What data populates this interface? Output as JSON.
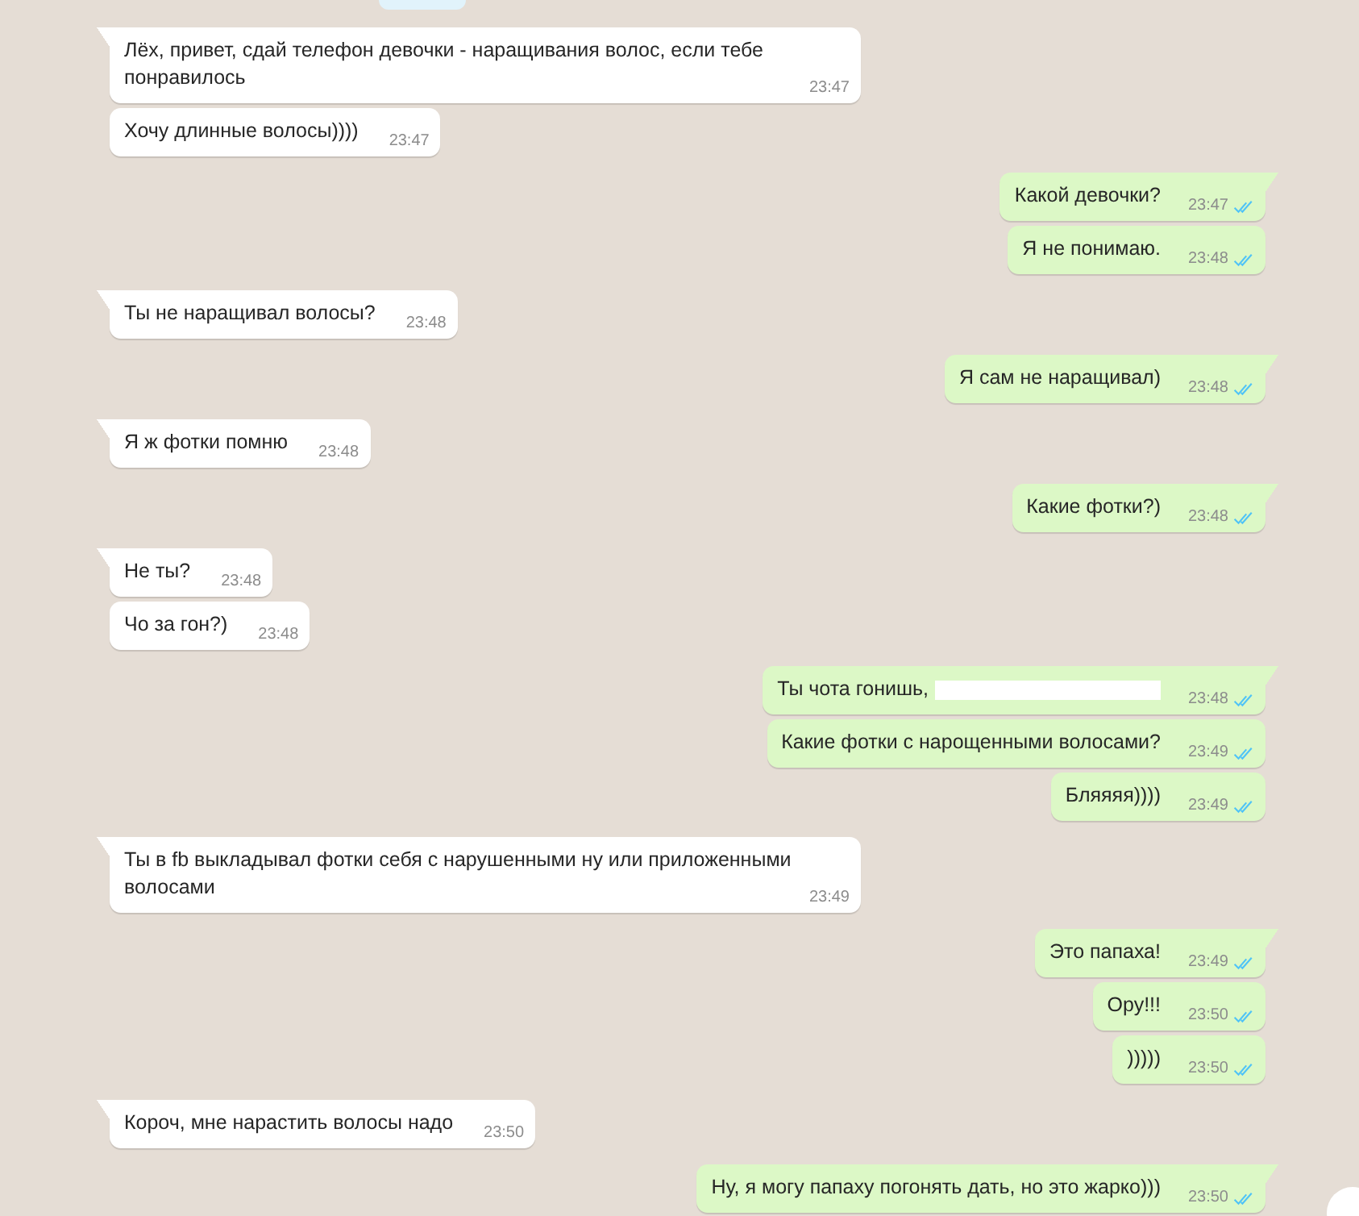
{
  "groups": [
    {
      "outgoing": false,
      "messages": [
        {
          "text": "Лёх, привет, сдай телефон девочки - наращивания волос, если тебе понравилось",
          "time": "23:47"
        },
        {
          "text": "Хочу длинные волосы))))",
          "time": "23:47"
        }
      ]
    },
    {
      "outgoing": true,
      "messages": [
        {
          "text": "Какой девочки?",
          "time": "23:47",
          "read": true
        },
        {
          "text": "Я не понимаю.",
          "time": "23:48",
          "read": true
        }
      ]
    },
    {
      "outgoing": false,
      "messages": [
        {
          "text": "Ты не наращивал волосы?",
          "time": "23:48"
        }
      ]
    },
    {
      "outgoing": true,
      "messages": [
        {
          "text": "Я сам не наращивал)",
          "time": "23:48",
          "read": true
        }
      ]
    },
    {
      "outgoing": false,
      "messages": [
        {
          "text": "Я ж фотки помню",
          "time": "23:48"
        }
      ]
    },
    {
      "outgoing": true,
      "messages": [
        {
          "text": "Какие фотки?)",
          "time": "23:48",
          "read": true
        }
      ]
    },
    {
      "outgoing": false,
      "messages": [
        {
          "text": "Не ты?",
          "time": "23:48"
        },
        {
          "text": "Чо за гон?)",
          "time": "23:48"
        }
      ]
    },
    {
      "outgoing": true,
      "messages": [
        {
          "text": "Ты чота гонишь,",
          "time": "23:48",
          "read": true,
          "redacted": true
        },
        {
          "text": "Какие фотки с нарощенными волосами?",
          "time": "23:49",
          "read": true
        },
        {
          "text": "Бляяяя))))",
          "time": "23:49",
          "read": true
        }
      ]
    },
    {
      "outgoing": false,
      "messages": [
        {
          "text": "Ты в fb выкладывал фотки себя с нарушенными ну или приложенными волосами",
          "time": "23:49"
        }
      ]
    },
    {
      "outgoing": true,
      "messages": [
        {
          "text": "Это папаха!",
          "time": "23:49",
          "read": true
        },
        {
          "text": "Ору!!!",
          "time": "23:50",
          "read": true
        },
        {
          "text": ")))))",
          "time": "23:50",
          "read": true
        }
      ]
    },
    {
      "outgoing": false,
      "messages": [
        {
          "text": "Короч, мне нарастить волосы надо",
          "time": "23:50"
        }
      ]
    },
    {
      "outgoing": true,
      "messages": [
        {
          "text": "Ну, я могу папаху погонять дать, но это жарко)))",
          "time": "23:50",
          "read": true
        }
      ]
    }
  ]
}
